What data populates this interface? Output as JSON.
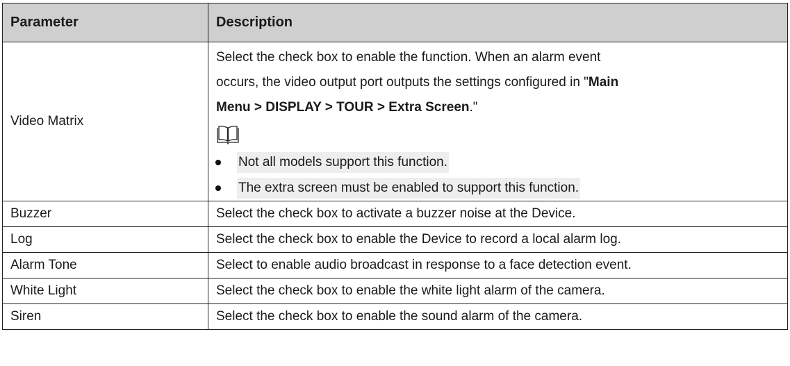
{
  "headers": {
    "parameter": "Parameter",
    "description": "Description"
  },
  "video_matrix": {
    "name": "Video Matrix",
    "text1": "Select the check box to enable the function. When an alarm event",
    "text2": "occurs, the video output port outputs the settings configured in \"",
    "bold1": "Main",
    "bold2": "Menu > DISPLAY > TOUR > Extra Screen",
    "text3": ".\"",
    "notes": [
      "Not all models support this function.",
      "The extra screen must be enabled to support this function."
    ]
  },
  "rows": [
    {
      "name": "Buzzer",
      "desc": "Select the check box to activate a buzzer noise at the Device."
    },
    {
      "name": "Log",
      "desc": "Select the check box to enable the Device to record a local alarm log."
    },
    {
      "name": "Alarm Tone",
      "desc": "Select to enable audio broadcast in response to a face detection event."
    },
    {
      "name": "White Light",
      "desc": "Select the check box to enable the white light alarm of the camera."
    },
    {
      "name": "Siren",
      "desc": "Select the check box to enable the sound alarm of the camera."
    }
  ]
}
